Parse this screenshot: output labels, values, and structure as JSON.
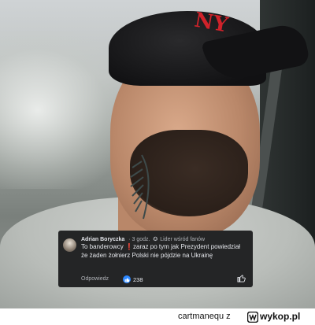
{
  "comment": {
    "author": "Adrian Boryczka",
    "time": "· 3 godz.",
    "fan_badge_icon": "star-badge-icon",
    "fan_badge": "Lider wśród fanów",
    "text": "To banderowcy ❗zaraz po tym jak Prezydent powiedział że żaden żołnierz Polski nie pójdzie na Ukrainę",
    "reply_label": "Odpowiedz",
    "like_count": "238",
    "like_color": "#2d88ff",
    "background": "#242526"
  },
  "footer": {
    "username": "cartmanequ",
    "separator": "z",
    "site": "wykop.pl"
  }
}
